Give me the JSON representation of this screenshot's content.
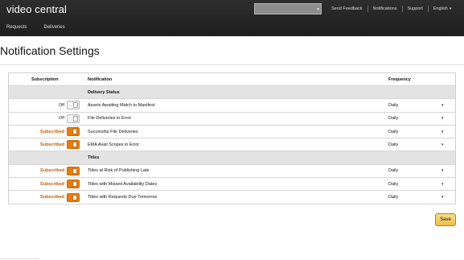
{
  "header": {
    "brand": "video central",
    "search": {
      "placeholder": "",
      "chevron": "▾"
    },
    "links": [
      "Send Feedback",
      "Notifications",
      "Support",
      "English"
    ],
    "language_chevron": "▾",
    "nav_tabs": [
      "Requests",
      "Deliveries"
    ]
  },
  "page": {
    "title": "Notification Settings"
  },
  "table": {
    "columns": [
      "Subscription",
      "Notification",
      "Frequency"
    ],
    "sections": [
      {
        "title": "Delivery Status",
        "rows": [
          {
            "subscription": "Off",
            "subscribed": false,
            "notification": "Assets Awaiting Match to Manifest",
            "frequency": "Daily"
          },
          {
            "subscription": "Off",
            "subscribed": false,
            "notification": "File Deliveries in Error",
            "frequency": "Daily"
          },
          {
            "subscription": "Subscribed",
            "subscribed": true,
            "notification": "Successful File Deliveries",
            "frequency": "Daily"
          },
          {
            "subscription": "Subscribed",
            "subscribed": true,
            "notification": "EMA Avail Scopes in Error",
            "frequency": "Daily"
          }
        ]
      },
      {
        "title": "Titles",
        "rows": [
          {
            "subscription": "Subscribed",
            "subscribed": true,
            "notification": "Titles at Risk of Publishing Late",
            "frequency": "Daily"
          },
          {
            "subscription": "Subscribed",
            "subscribed": true,
            "notification": "Titles with Missed Availability Dates",
            "frequency": "Daily"
          },
          {
            "subscription": "Subscribed",
            "subscribed": true,
            "notification": "Titles with Requests Due Tomorrow",
            "frequency": "Daily"
          }
        ]
      }
    ],
    "dropdown_chevron": "▾"
  },
  "actions": {
    "save_label": "Save"
  },
  "colors": {
    "topbar": "#232323",
    "subscribed_text": "#c35a00",
    "toggle_on": "#e57d0f",
    "save_button": "#f0c14b",
    "section_bg": "#e3e3e3"
  }
}
